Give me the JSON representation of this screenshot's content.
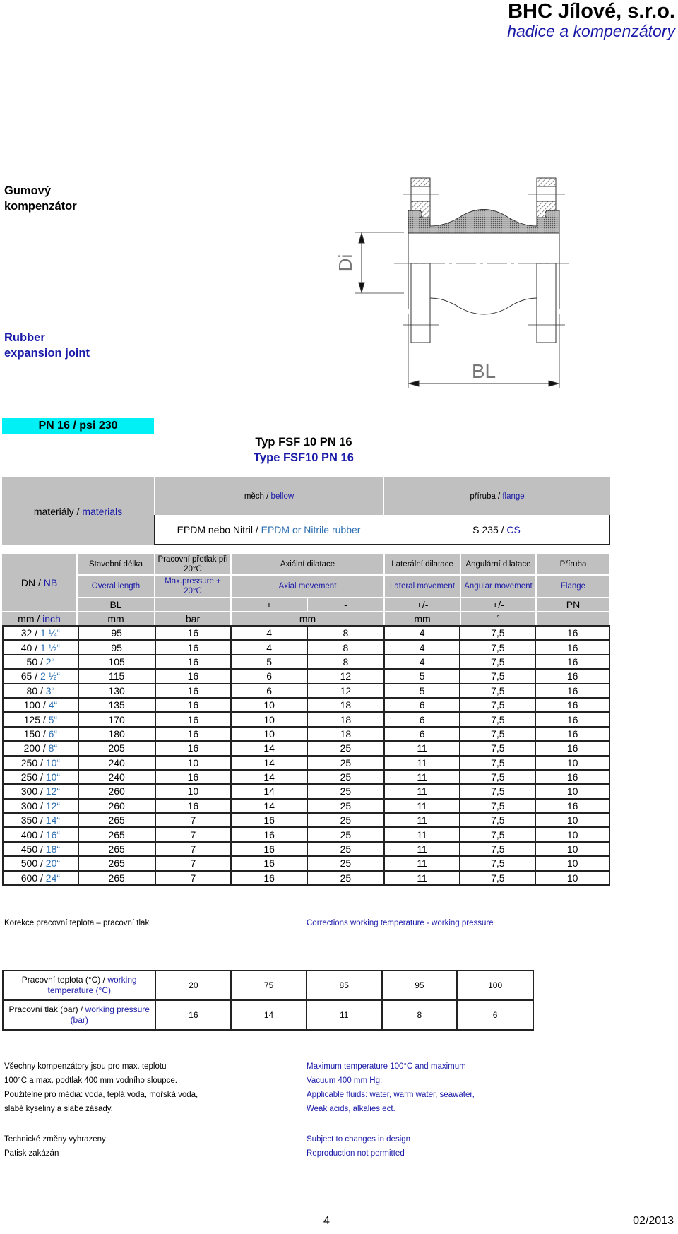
{
  "header": {
    "company": "BHC Jílové, s.r.o.",
    "tagline": "hadice a kompenzátory"
  },
  "product": {
    "title_cz_line1": "Gumový",
    "title_cz_line2": "kompenzátor",
    "title_en_line1": "Rubber",
    "title_en_line2": "expansion joint",
    "pn_badge": "PN 16 / psi 230",
    "type_cz": "Typ FSF 10 PN 16",
    "type_en": "Type FSF10 PN 16"
  },
  "drawing": {
    "label_di": "Di",
    "label_bl": "BL"
  },
  "materials": {
    "label_cz": "materiály / ",
    "label_en": "materials",
    "bellow_cz": "měch / ",
    "bellow_en": "bellow",
    "bellow_value_cz": "EPDM nebo Nitril / ",
    "bellow_value_en": "EPDM or Nitrile rubber",
    "flange_cz": "příruba / ",
    "flange_en": "flange",
    "flange_value_cz": "S 235 / ",
    "flange_value_en": "CS"
  },
  "main_table": {
    "headers": {
      "dn_cz": "DN / ",
      "dn_en": "NB",
      "length_cz": "Stavební délka",
      "length_en": "Overal length",
      "length_sym": "BL",
      "pressure_cz": "Pracovní přetlak při 20°C",
      "pressure_en": "Max.pressure + 20°C",
      "axial_cz": "Axiální dilatace",
      "axial_en": "Axial movement",
      "axial_plus": "+",
      "axial_minus": "-",
      "lateral_cz": "Laterální dilatace",
      "lateral_en": "Lateral movement",
      "lateral_sym": "+/-",
      "angular_cz": "Angulární dilatace",
      "angular_en": "Angular movement",
      "angular_sym": "+/-",
      "flange_cz": "Příruba",
      "flange_en": "Flange",
      "flange_sym": "PN"
    },
    "units": {
      "dn_cz": "mm / ",
      "dn_en": "inch",
      "length": "mm",
      "pressure": "bar",
      "axial": "mm",
      "lateral": "mm",
      "angular": "°",
      "flange": ""
    },
    "rows": [
      {
        "dn": "32 / ",
        "inch": "1 ¼“",
        "bl": "95",
        "bar": "16",
        "ax_plus": "4",
        "ax_minus": "8",
        "lat": "4",
        "ang": "7,5",
        "pn": "16"
      },
      {
        "dn": "40 / ",
        "inch": "1 ½“",
        "bl": "95",
        "bar": "16",
        "ax_plus": "4",
        "ax_minus": "8",
        "lat": "4",
        "ang": "7,5",
        "pn": "16"
      },
      {
        "dn": "50 / ",
        "inch": "2“",
        "bl": "105",
        "bar": "16",
        "ax_plus": "5",
        "ax_minus": "8",
        "lat": "4",
        "ang": "7,5",
        "pn": "16"
      },
      {
        "dn": "65 / ",
        "inch": "2 ½“",
        "bl": "115",
        "bar": "16",
        "ax_plus": "6",
        "ax_minus": "12",
        "lat": "5",
        "ang": "7,5",
        "pn": "16"
      },
      {
        "dn": "80 / ",
        "inch": "3“",
        "bl": "130",
        "bar": "16",
        "ax_plus": "6",
        "ax_minus": "12",
        "lat": "5",
        "ang": "7,5",
        "pn": "16"
      },
      {
        "dn": "100 / ",
        "inch": "4“",
        "bl": "135",
        "bar": "16",
        "ax_plus": "10",
        "ax_minus": "18",
        "lat": "6",
        "ang": "7,5",
        "pn": "16"
      },
      {
        "dn": "125 / ",
        "inch": "5“",
        "bl": "170",
        "bar": "16",
        "ax_plus": "10",
        "ax_minus": "18",
        "lat": "6",
        "ang": "7,5",
        "pn": "16"
      },
      {
        "dn": "150 / ",
        "inch": "6“",
        "bl": "180",
        "bar": "16",
        "ax_plus": "10",
        "ax_minus": "18",
        "lat": "6",
        "ang": "7,5",
        "pn": "16"
      },
      {
        "dn": "200 / ",
        "inch": "8“",
        "bl": "205",
        "bar": "16",
        "ax_plus": "14",
        "ax_minus": "25",
        "lat": "11",
        "ang": "7,5",
        "pn": "16"
      },
      {
        "dn": "250 / ",
        "inch": "10“",
        "bl": "240",
        "bar": "10",
        "ax_plus": "14",
        "ax_minus": "25",
        "lat": "11",
        "ang": "7,5",
        "pn": "10"
      },
      {
        "dn": "250 / ",
        "inch": "10“",
        "bl": "240",
        "bar": "16",
        "ax_plus": "14",
        "ax_minus": "25",
        "lat": "11",
        "ang": "7,5",
        "pn": "16"
      },
      {
        "dn": "300 / ",
        "inch": "12“",
        "bl": "260",
        "bar": "10",
        "ax_plus": "14",
        "ax_minus": "25",
        "lat": "11",
        "ang": "7,5",
        "pn": "10"
      },
      {
        "dn": "300 / ",
        "inch": "12“",
        "bl": "260",
        "bar": "16",
        "ax_plus": "14",
        "ax_minus": "25",
        "lat": "11",
        "ang": "7,5",
        "pn": "16"
      },
      {
        "dn": "350 / ",
        "inch": "14“",
        "bl": "265",
        "bar": "7",
        "ax_plus": "16",
        "ax_minus": "25",
        "lat": "11",
        "ang": "7,5",
        "pn": "10"
      },
      {
        "dn": "400 / ",
        "inch": "16“",
        "bl": "265",
        "bar": "7",
        "ax_plus": "16",
        "ax_minus": "25",
        "lat": "11",
        "ang": "7,5",
        "pn": "10"
      },
      {
        "dn": "450 / ",
        "inch": "18“",
        "bl": "265",
        "bar": "7",
        "ax_plus": "16",
        "ax_minus": "25",
        "lat": "11",
        "ang": "7,5",
        "pn": "10"
      },
      {
        "dn": "500 / ",
        "inch": "20“",
        "bl": "265",
        "bar": "7",
        "ax_plus": "16",
        "ax_minus": "25",
        "lat": "11",
        "ang": "7,5",
        "pn": "10"
      },
      {
        "dn": "600 / ",
        "inch": "24“",
        "bl": "265",
        "bar": "7",
        "ax_plus": "16",
        "ax_minus": "25",
        "lat": "11",
        "ang": "7,5",
        "pn": "10"
      }
    ]
  },
  "corrections": {
    "title_cz": "Korekce pracovní teplota  – pracovní tlak",
    "title_en": "Corrections  working temperature - working pressure",
    "temp_label_cz": "Pracovní teplota (°C) / ",
    "temp_label_en": "working temperature (°C)",
    "pressure_label_cz": "Pracovní tlak  (bar) / ",
    "pressure_label_en": "working pressure (bar)",
    "temperatures": [
      "20",
      "75",
      "85",
      "95",
      "100"
    ],
    "pressures": [
      "16",
      "14",
      "11",
      "8",
      "6"
    ]
  },
  "notes": {
    "cz": [
      "Všechny kompenzátory jsou pro max. teplotu",
      "100°C  a max. podtlak 400 mm vodního sloupce.",
      "Použitelné pro média: voda, teplá voda, mořská voda,",
      "slabé kyseliny a slabé zásady."
    ],
    "en": [
      "Maximum temperature 100°C and maximum",
      "Vacuum 400 mm Hg.",
      "Applicable fluids: water, warm water, seawater,",
      "Weak acids, alkalies ect."
    ],
    "legal_cz": [
      "Technické změny vyhrazeny",
      "Patisk zakázán"
    ],
    "legal_en": [
      "Subject to changes in design",
      "Reproduction not permitted"
    ]
  },
  "footer": {
    "page": "4",
    "date": "02/2013"
  }
}
